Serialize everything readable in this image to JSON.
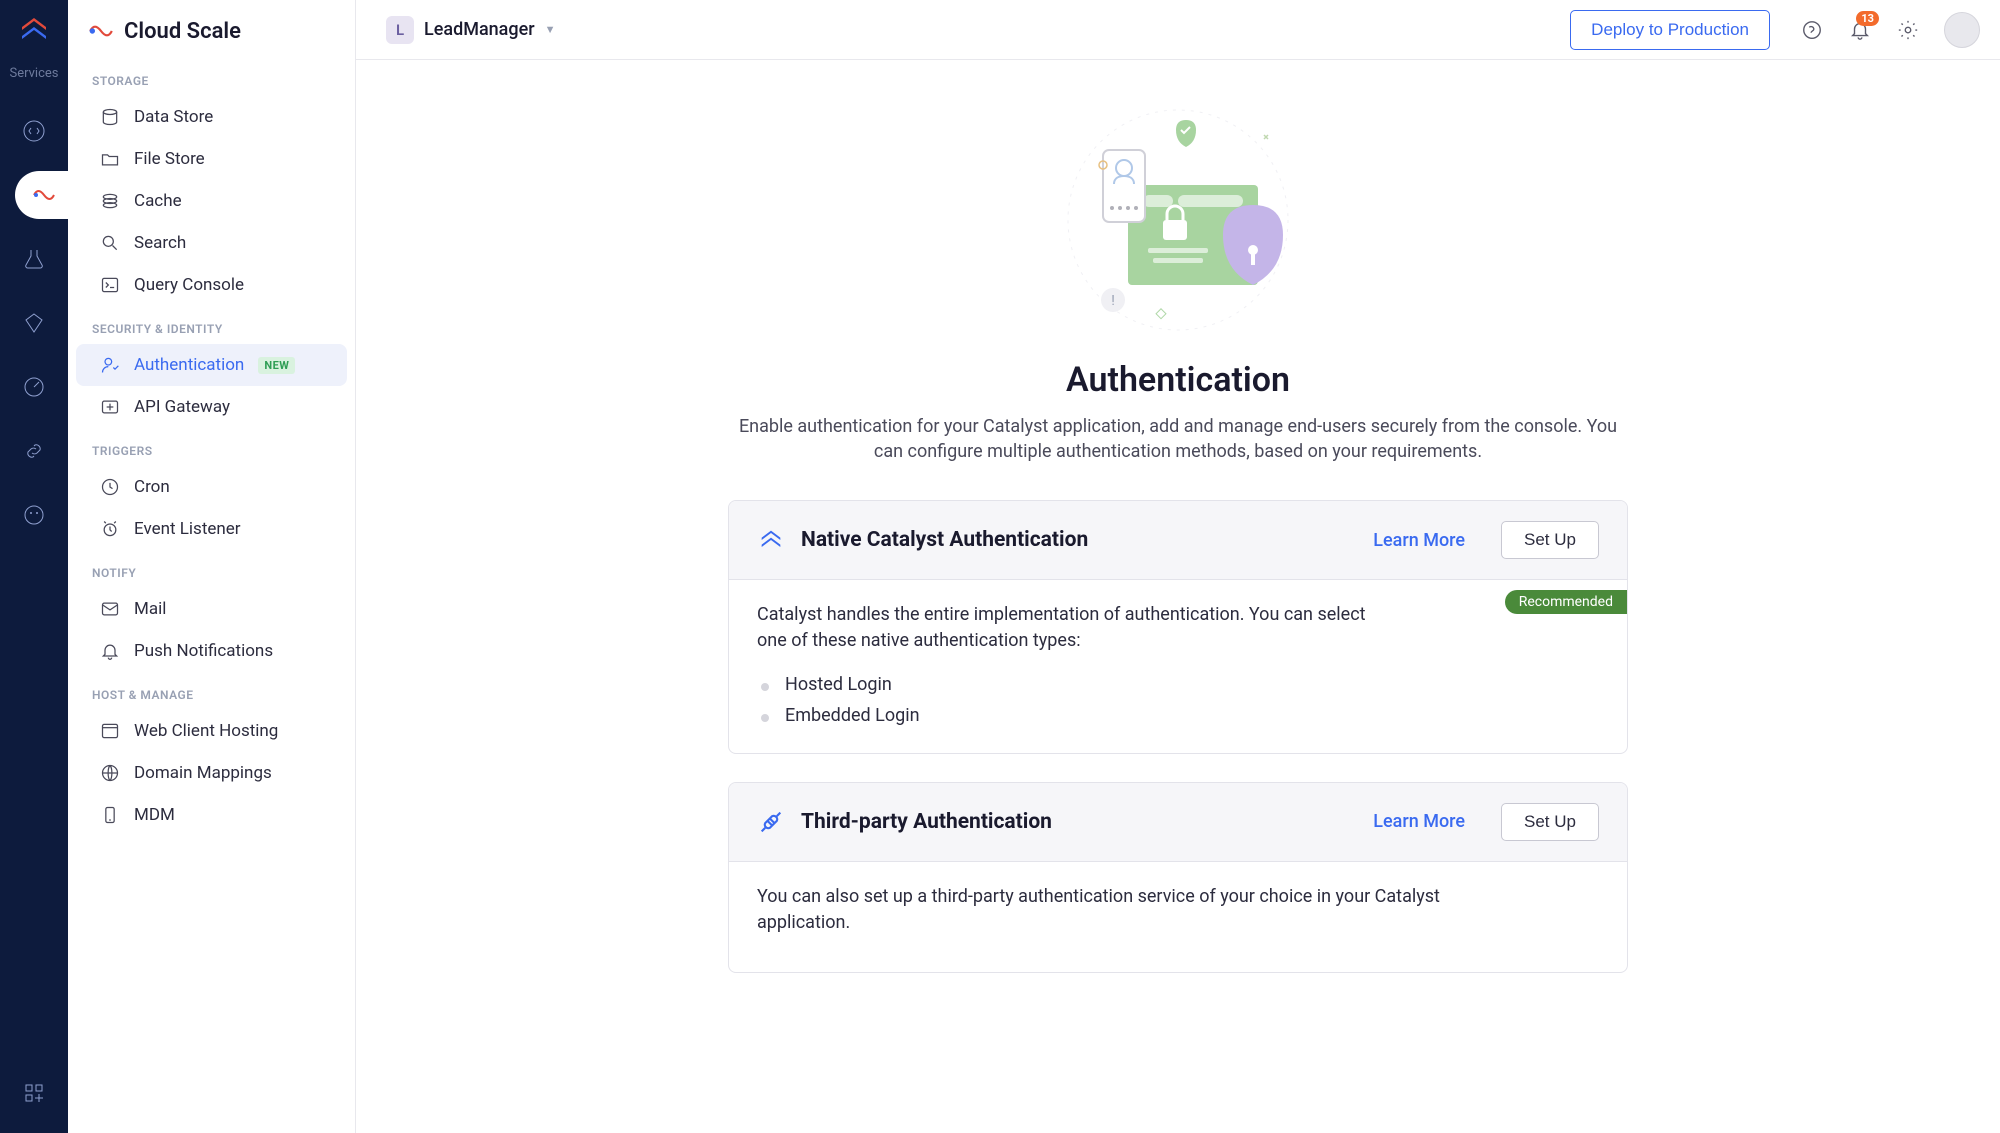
{
  "rail": {
    "services_label": "Services"
  },
  "topbar": {
    "project_initial": "L",
    "project_name": "LeadManager",
    "deploy_label": "Deploy to Production",
    "notif_count": "13"
  },
  "sidebar": {
    "brand": "Cloud Scale",
    "sections": {
      "storage": {
        "label": "STORAGE",
        "items": [
          "Data Store",
          "File Store",
          "Cache",
          "Search",
          "Query Console"
        ]
      },
      "security": {
        "label": "SECURITY & IDENTITY",
        "items": [
          "Authentication",
          "API Gateway"
        ],
        "auth_badge": "NEW"
      },
      "triggers": {
        "label": "TRIGGERS",
        "items": [
          "Cron",
          "Event Listener"
        ]
      },
      "notify": {
        "label": "NOTIFY",
        "items": [
          "Mail",
          "Push Notifications"
        ]
      },
      "host": {
        "label": "HOST & MANAGE",
        "items": [
          "Web Client Hosting",
          "Domain Mappings",
          "MDM"
        ]
      }
    }
  },
  "page": {
    "title": "Authentication",
    "description": "Enable authentication for your Catalyst application, add and manage end-users securely from the console. You can configure multiple authentication methods, based on your requirements.",
    "card1": {
      "title": "Native Catalyst Authentication",
      "learn": "Learn More",
      "setup": "Set Up",
      "desc": "Catalyst handles the entire implementation of authentication. You can select one of these native authentication types:",
      "items": [
        "Hosted Login",
        "Embedded Login"
      ],
      "recommended": "Recommended"
    },
    "card2": {
      "title": "Third-party Authentication",
      "learn": "Learn More",
      "setup": "Set Up",
      "desc": "You can also set up a third-party authentication service of your choice in your Catalyst application."
    }
  }
}
